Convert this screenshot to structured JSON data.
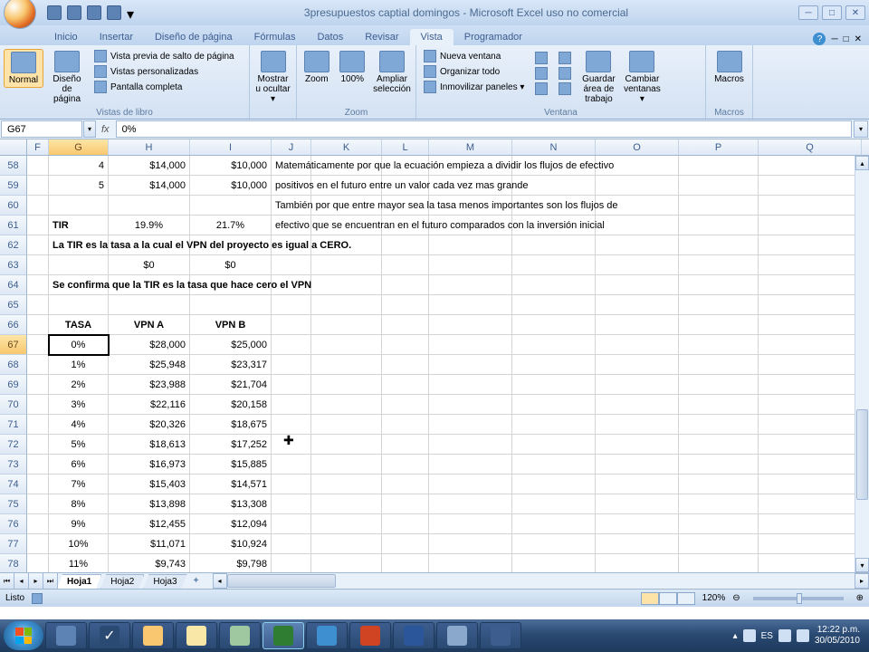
{
  "title": "3presupuestos captial domingos - Microsoft Excel uso no comercial",
  "tabs": [
    "Inicio",
    "Insertar",
    "Diseño de página",
    "Fórmulas",
    "Datos",
    "Revisar",
    "Vista",
    "Programador"
  ],
  "active_tab": "Vista",
  "ribbon": {
    "vistas": {
      "label": "Vistas de libro",
      "normal": "Normal",
      "diseno": "Diseño de página",
      "salto": "Vista previa de salto de página",
      "pers": "Vistas personalizadas",
      "pant": "Pantalla completa"
    },
    "mostrar": {
      "mostrar": "Mostrar u ocultar ▾"
    },
    "zoom": {
      "label": "Zoom",
      "zoom": "Zoom",
      "cien": "100%",
      "amp": "Ampliar selección"
    },
    "ventana": {
      "label": "Ventana",
      "nueva": "Nueva ventana",
      "org": "Organizar todo",
      "inm": "Inmovilizar paneles ▾",
      "guardar": "Guardar área de trabajo",
      "cambiar": "Cambiar ventanas ▾"
    },
    "macros": {
      "label": "Macros",
      "macros": "Macros"
    }
  },
  "namebox": "G67",
  "formula": "0%",
  "cols": [
    "F",
    "G",
    "H",
    "I",
    "J",
    "K",
    "L",
    "M",
    "N",
    "O",
    "P",
    "Q"
  ],
  "active_col": "G",
  "rows_start": 58,
  "rows_end": 78,
  "active_row": 67,
  "grid": {
    "58": {
      "G": "4",
      "H": "$14,000",
      "I": "$10,000",
      "Jtext": "Matemáticamente por que la ecuación empieza a dividir los flujos de efectivo"
    },
    "59": {
      "G": "5",
      "H": "$14,000",
      "I": "$10,000",
      "Jtext": "positivos en el futuro entre un valor cada vez mas grande"
    },
    "60": {
      "Jtext": "También por que entre mayor sea la tasa menos importantes son los flujos de"
    },
    "61": {
      "G": "TIR",
      "H": "19.9%",
      "I": "21.7%",
      "Jtext": "efectivo que se encuentran en el futuro comparados con la inversión inicial"
    },
    "62": {
      "Gtext": "La TIR es la tasa a la cual el VPN del proyecto es igual a CERO."
    },
    "63": {
      "H": "$0",
      "I": "$0"
    },
    "64": {
      "Gtext": "Se confirma que la TIR es la tasa que hace cero el VPN"
    },
    "65": {},
    "66": {
      "G": "TASA",
      "H": "VPN A",
      "I": "VPN B"
    },
    "67": {
      "G": "0%",
      "H": "$28,000",
      "I": "$25,000"
    },
    "68": {
      "G": "1%",
      "H": "$25,948",
      "I": "$23,317"
    },
    "69": {
      "G": "2%",
      "H": "$23,988",
      "I": "$21,704"
    },
    "70": {
      "G": "3%",
      "H": "$22,116",
      "I": "$20,158"
    },
    "71": {
      "G": "4%",
      "H": "$20,326",
      "I": "$18,675"
    },
    "72": {
      "G": "5%",
      "H": "$18,613",
      "I": "$17,252"
    },
    "73": {
      "G": "6%",
      "H": "$16,973",
      "I": "$15,885"
    },
    "74": {
      "G": "7%",
      "H": "$15,403",
      "I": "$14,571"
    },
    "75": {
      "G": "8%",
      "H": "$13,898",
      "I": "$13,308"
    },
    "76": {
      "G": "9%",
      "H": "$12,455",
      "I": "$12,094"
    },
    "77": {
      "G": "10%",
      "H": "$11,071",
      "I": "$10,924"
    },
    "78": {
      "G": "11%",
      "H": "$9,743",
      "I": "$9,798"
    }
  },
  "sheets": [
    "Hoja1",
    "Hoja2",
    "Hoja3"
  ],
  "active_sheet": "Hoja1",
  "status": "Listo",
  "zoom": "120%",
  "clock": {
    "time": "12:22 p.m.",
    "date": "30/05/2010"
  },
  "lang": "ES"
}
